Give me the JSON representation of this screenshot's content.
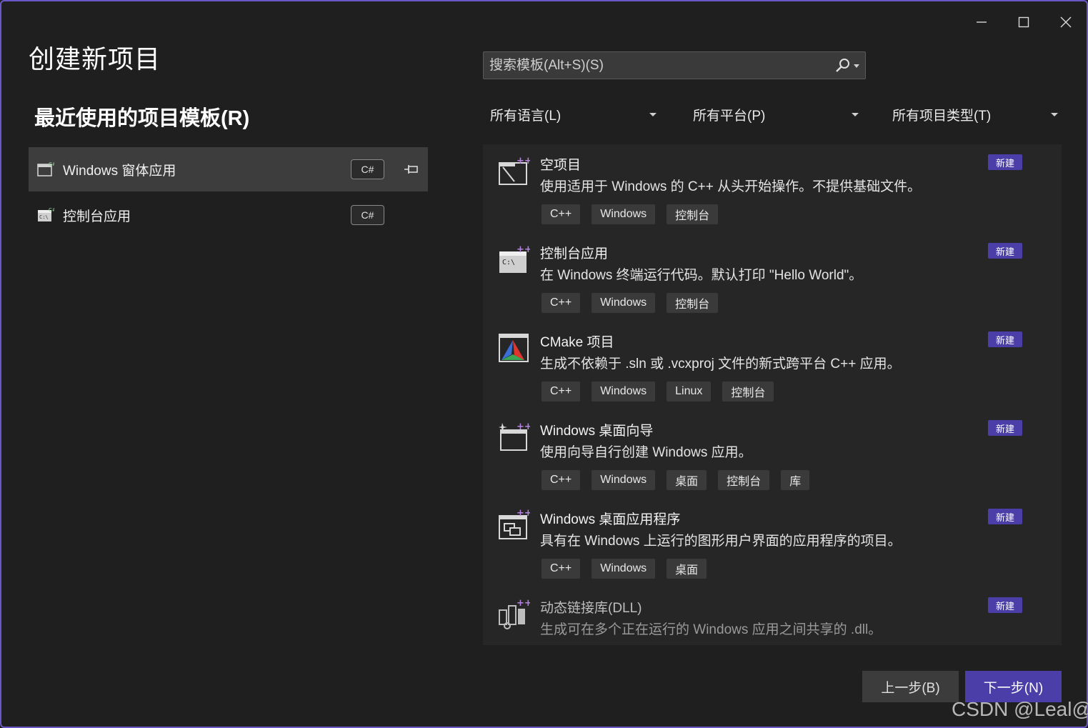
{
  "window": {
    "title": "创建新项目",
    "controls": {
      "minimize_icon": "minimize-icon",
      "maximize_icon": "maximize-icon",
      "close_icon": "close-icon"
    }
  },
  "recent": {
    "title": "最近使用的项目模板(R)",
    "items": [
      {
        "label": "Windows 窗体应用",
        "lang": "C#",
        "icon": "windows-forms-icon",
        "pinned": true,
        "selected": true
      },
      {
        "label": "控制台应用",
        "lang": "C#",
        "icon": "console-app-icon",
        "pinned": false,
        "selected": false
      }
    ]
  },
  "search": {
    "placeholder": "搜索模板(Alt+S)(S)"
  },
  "filters": {
    "language": "所有语言(L)",
    "platform": "所有平台(P)",
    "project_type": "所有项目类型(T)"
  },
  "templates": [
    {
      "name": "空项目",
      "description": "使用适用于 Windows 的 C++ 从头开始操作。不提供基础文件。",
      "badge": "新建",
      "tags": [
        "C++",
        "Windows",
        "控制台"
      ],
      "icon": "empty-project-icon"
    },
    {
      "name": "控制台应用",
      "description": "在 Windows 终端运行代码。默认打印 \"Hello World\"。",
      "badge": "新建",
      "tags": [
        "C++",
        "Windows",
        "控制台"
      ],
      "icon": "console-app-icon"
    },
    {
      "name": "CMake 项目",
      "description": "生成不依赖于 .sln 或 .vcxproj 文件的新式跨平台 C++ 应用。",
      "badge": "新建",
      "tags": [
        "C++",
        "Windows",
        "Linux",
        "控制台"
      ],
      "icon": "cmake-icon"
    },
    {
      "name": "Windows 桌面向导",
      "description": "使用向导自行创建 Windows 应用。",
      "badge": "新建",
      "tags": [
        "C++",
        "Windows",
        "桌面",
        "控制台",
        "库"
      ],
      "icon": "desktop-wizard-icon"
    },
    {
      "name": "Windows 桌面应用程序",
      "description": "具有在 Windows 上运行的图形用户界面的应用程序的项目。",
      "badge": "新建",
      "tags": [
        "C++",
        "Windows",
        "桌面"
      ],
      "icon": "desktop-app-icon"
    },
    {
      "name": "动态链接库(DLL)",
      "description": "生成可在多个正在运行的 Windows 应用之间共享的 .dll。",
      "badge": "新建",
      "tags": [],
      "icon": "dll-icon"
    }
  ],
  "buttons": {
    "back": "上一步(B)",
    "next": "下一步(N)"
  },
  "watermark": "CSDN @Leal@",
  "colors": {
    "accent": "#4b3ea8",
    "border": "#6b57c7",
    "background": "#1f1f1f"
  }
}
